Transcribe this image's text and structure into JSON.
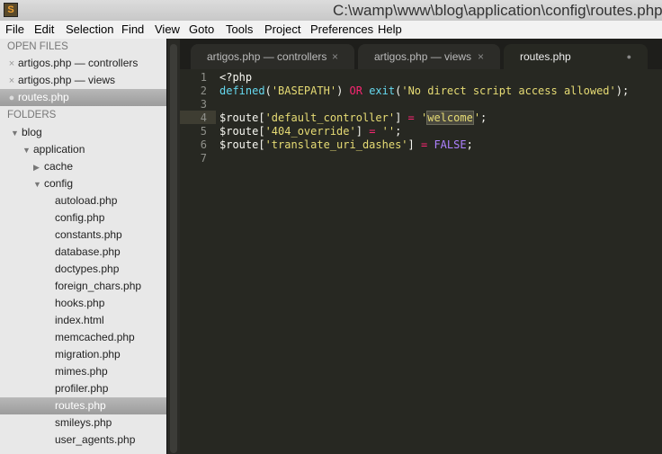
{
  "window": {
    "title": "C:\\wamp\\www\\blog\\application\\config\\routes.php • (b",
    "icon_letter": "S"
  },
  "menu": [
    "File",
    "Edit",
    "Selection",
    "Find",
    "View",
    "Goto",
    "Tools",
    "Project",
    "Preferences",
    "Help"
  ],
  "sidebar": {
    "open_files_header": "OPEN FILES",
    "open_files": [
      "artigos.php — controllers",
      "artigos.php — views",
      "routes.php"
    ],
    "folders_header": "FOLDERS",
    "tree": {
      "blog": "blog",
      "application": "application",
      "cache": "cache",
      "config": "config",
      "files": [
        "autoload.php",
        "config.php",
        "constants.php",
        "database.php",
        "doctypes.php",
        "foreign_chars.php",
        "hooks.php",
        "index.html",
        "memcached.php",
        "migration.php",
        "mimes.php",
        "profiler.php",
        "routes.php",
        "smileys.php",
        "user_agents.php"
      ]
    }
  },
  "tabs": [
    {
      "label": "artigos.php — controllers",
      "close": "×"
    },
    {
      "label": "artigos.php — views",
      "close": "×"
    },
    {
      "label": "routes.php",
      "close": "●"
    }
  ],
  "editor": {
    "line_numbers": [
      "1",
      "2",
      "3",
      "4",
      "5",
      "6",
      "7"
    ],
    "l1": "<?php",
    "l2": {
      "a": "defined",
      "b": "(",
      "c": "'BASEPATH'",
      "d": ") ",
      "e": "OR",
      "f": " ",
      "g": "exit",
      "h": "(",
      "i": "'No direct script access allowed'",
      "j": ");"
    },
    "l4": {
      "a": "$route[",
      "b": "'default_controller'",
      "c": "] ",
      "d": "=",
      "e": " ",
      "f": "'",
      "g": "welcome",
      "h": "'",
      "i": ";"
    },
    "l5": {
      "a": "$route[",
      "b": "'404_override'",
      "c": "] ",
      "d": "=",
      "e": " ",
      "f": "''",
      "g": ";"
    },
    "l6": {
      "a": "$route[",
      "b": "'translate_uri_dashes'",
      "c": "] ",
      "d": "=",
      "e": " ",
      "f": "FALSE",
      "g": ";"
    }
  }
}
